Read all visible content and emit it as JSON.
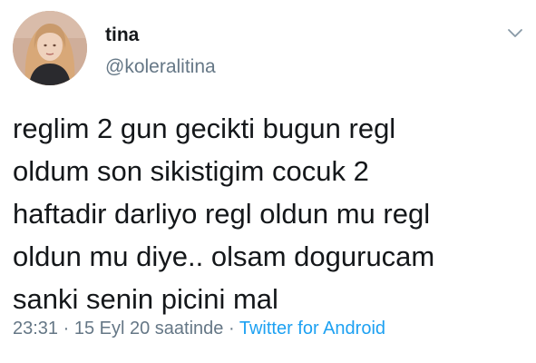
{
  "tweet": {
    "author": {
      "display_name": "tina",
      "handle": "@koleralitina"
    },
    "text": "reglim 2 gun gecikti bugun regl\noldum son sikistigim cocuk 2\nhaftadir darliyo regl oldun mu regl\noldun mu diye.. olsam dogurucam\nsanki senin picini mal",
    "time": "23:31",
    "separator_1": " · ",
    "date": "15 Eyl 20 saatinde",
    "separator_2": " · ",
    "source": "Twitter for Android",
    "menu_icon": "chevron-down-icon"
  },
  "colors": {
    "text": "#14171a",
    "secondary": "#657786",
    "link": "#1da1f2",
    "background": "#ffffff"
  }
}
